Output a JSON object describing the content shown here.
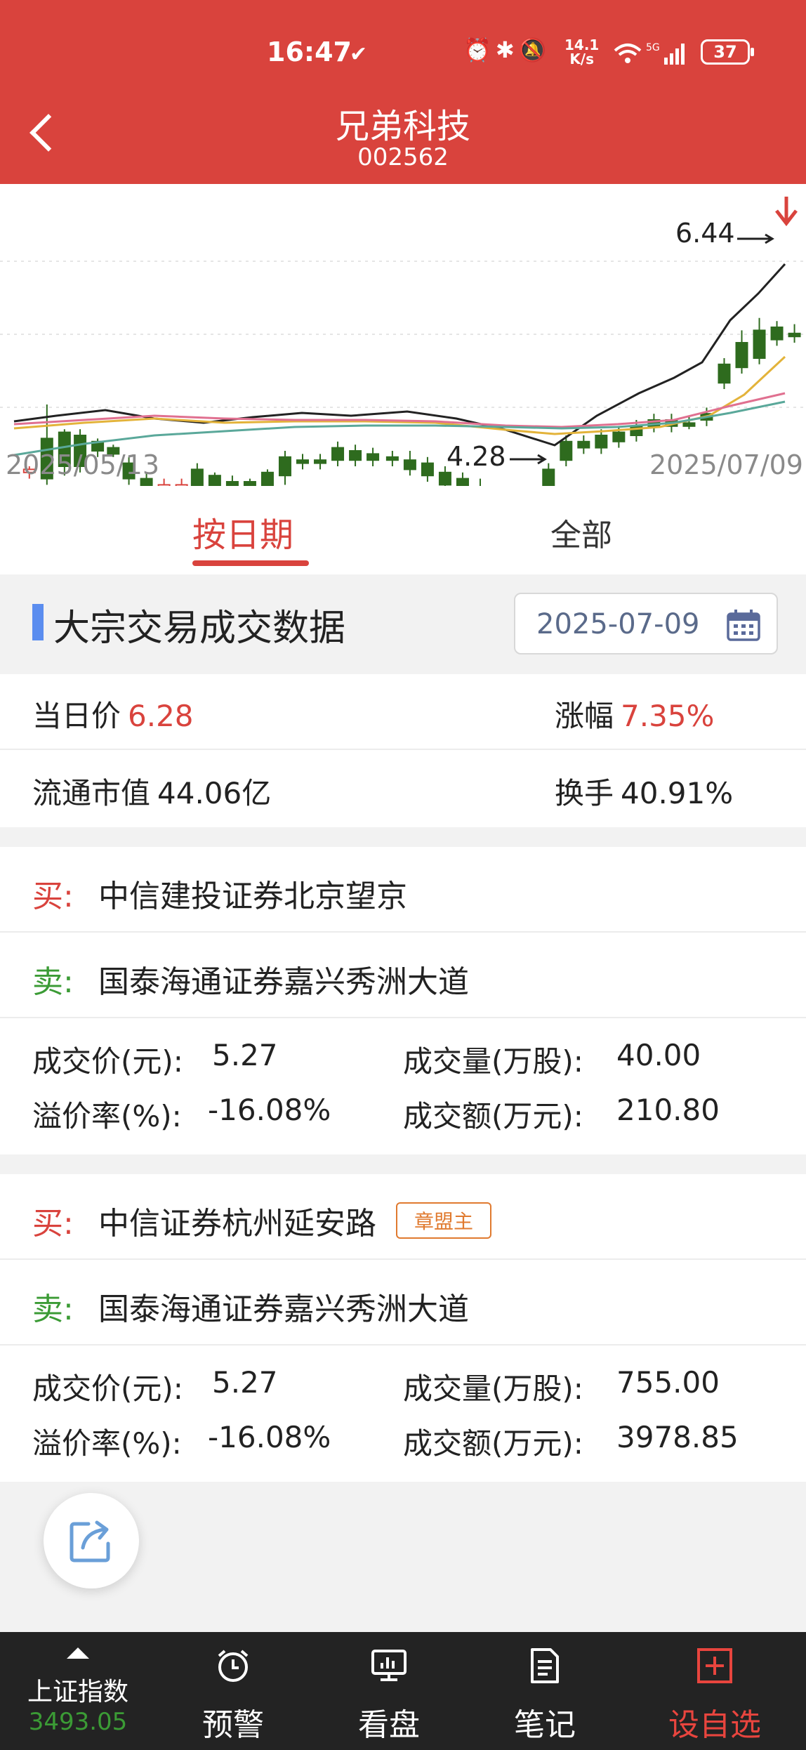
{
  "status_bar": {
    "time": "16:47",
    "speed_value": "14.1",
    "speed_unit": "K/s",
    "battery": "37"
  },
  "header": {
    "title": "兄弟科技",
    "code": "002562"
  },
  "chart": {
    "start_date": "2025/05/13",
    "end_date": "2025/07/09",
    "high_label": "6.44",
    "low_label": "4.28"
  },
  "tabs": {
    "by_date": "按日期",
    "all": "全部"
  },
  "section": {
    "title": "大宗交易成交数据",
    "date": "2025-07-09"
  },
  "summary": {
    "price_label": "当日价",
    "price_value": "6.28",
    "change_label": "涨幅",
    "change_value": "7.35%",
    "cap_label": "流通市值",
    "cap_value": "44.06亿",
    "turnover_label": "换手",
    "turnover_value": "40.91%"
  },
  "trades": [
    {
      "buy_prefix": "买:",
      "buyer": "中信建投证券北京望京",
      "tag": "",
      "sell_prefix": "卖:",
      "seller": "国泰海通证券嘉兴秀洲大道",
      "price_label": "成交价(元):",
      "price": "5.27",
      "volume_label": "成交量(万股):",
      "volume": "40.00",
      "premium_label": "溢价率(%):",
      "premium": "-16.08%",
      "amount_label": "成交额(万元):",
      "amount": "210.80"
    },
    {
      "buy_prefix": "买:",
      "buyer": "中信证券杭州延安路",
      "tag": "章盟主",
      "sell_prefix": "卖:",
      "seller": "国泰海通证券嘉兴秀洲大道",
      "price_label": "成交价(元):",
      "price": "5.27",
      "volume_label": "成交量(万股):",
      "volume": "755.00",
      "premium_label": "溢价率(%):",
      "premium": "-16.08%",
      "amount_label": "成交额(万元):",
      "amount": "3978.85"
    }
  ],
  "bottom_nav": {
    "index_name": "上证指数",
    "index_value": "3493.05",
    "items": [
      "预警",
      "看盘",
      "笔记",
      "设自选"
    ]
  },
  "colors": {
    "brand_red": "#d9433d",
    "down_green": "#3b9b35",
    "nav_bg": "#232323"
  }
}
